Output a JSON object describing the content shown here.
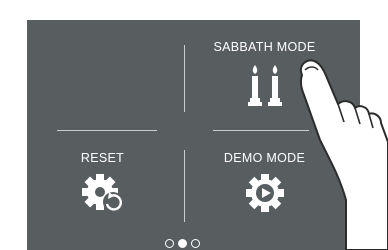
{
  "menu": {
    "tiles": [
      {
        "label": "",
        "icon": "empty"
      },
      {
        "label": "SABBATH MODE",
        "icon": "candles-icon"
      },
      {
        "label": "RESET",
        "icon": "gear-reset-icon"
      },
      {
        "label": "DEMO MODE",
        "icon": "gear-play-icon"
      }
    ]
  },
  "pagination": {
    "pages": 3,
    "current": 2
  },
  "colors": {
    "screen_background": "#585d60",
    "text": "#ffffff",
    "divider": "#c9cbcc"
  }
}
